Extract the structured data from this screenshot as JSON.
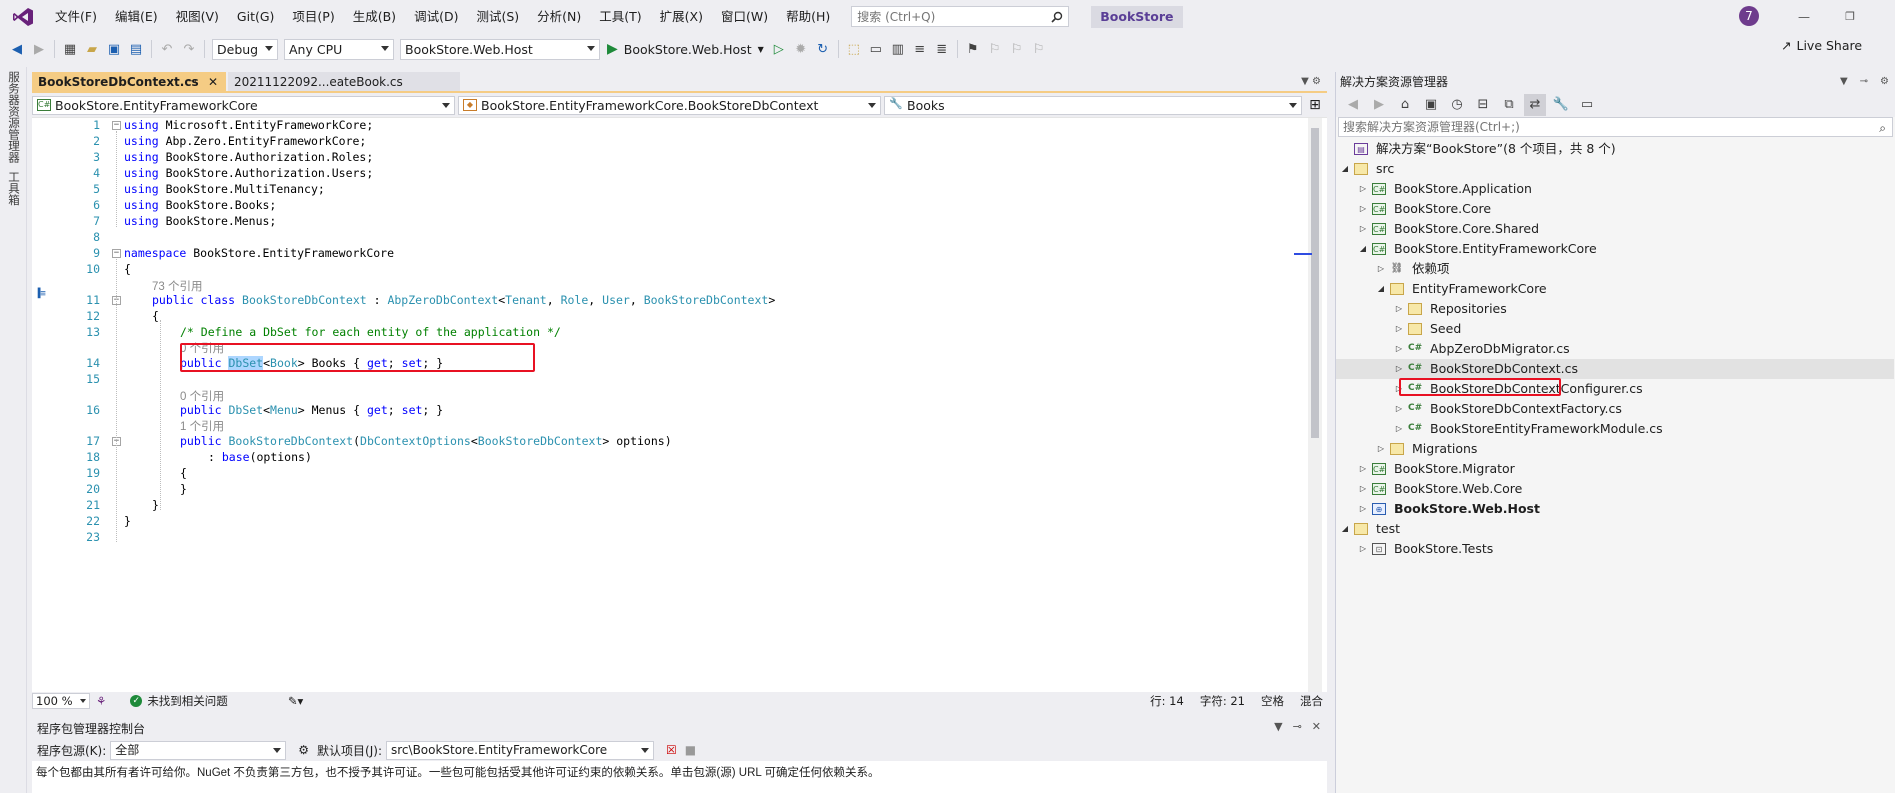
{
  "menubar": {
    "items": [
      "文件(F)",
      "编辑(E)",
      "视图(V)",
      "Git(G)",
      "项目(P)",
      "生成(B)",
      "调试(D)",
      "测试(S)",
      "分析(N)",
      "工具(T)",
      "扩展(X)",
      "窗口(W)",
      "帮助(H)"
    ],
    "search_placeholder": "搜索 (Ctrl+Q)",
    "solution_name": "BookStore",
    "notification_count": "7"
  },
  "toolbar": {
    "configuration": "Debug",
    "platform": "Any CPU",
    "startup_project": "BookStore.Web.Host",
    "run_target": "BookStore.Web.Host",
    "live_share": "Live Share"
  },
  "left_strip": {
    "tab1": "服务器资源管理器",
    "tab2": "工具箱"
  },
  "editor": {
    "tabs": [
      {
        "label": "BookStoreDbContext.cs",
        "active": true
      },
      {
        "label": "20211122092...eateBook.cs",
        "active": false
      }
    ],
    "nav_project": "BookStore.EntityFrameworkCore",
    "nav_class": "BookStore.EntityFrameworkCore.BookStoreDbContext",
    "nav_member": "Books",
    "line_numbers": [
      "1",
      "2",
      "3",
      "4",
      "5",
      "6",
      "7",
      "8",
      "9",
      "10",
      "11",
      "12",
      "13",
      "14",
      "15",
      "16",
      "17",
      "18",
      "19",
      "20",
      "21",
      "22",
      "23"
    ],
    "code": {
      "l1": "Microsoft.EntityFrameworkCore;",
      "l2": "Abp.Zero.EntityFrameworkCore;",
      "l3": "BookStore.Authorization.Roles;",
      "l4": "BookStore.Authorization.Users;",
      "l5": "BookStore.MultiTenancy;",
      "l6": "BookStore.Books;",
      "l7": "BookStore.Menus;",
      "l9": "BookStore.EntityFrameworkCore",
      "ref73": "73 个引用",
      "ref0a": "0 个引用",
      "ref0b": "0 个引用",
      "ref1": "1 个引用",
      "comment": "/* Define a DbSet for each entity of the application */"
    }
  },
  "status": {
    "zoom": "100 %",
    "issues": "未找到相关问题",
    "line": "行: 14",
    "col": "字符: 21",
    "ws": "空格",
    "eol": "混合"
  },
  "pmc": {
    "title": "程序包管理器控制台",
    "source_label": "程序包源(K):",
    "source_value": "全部",
    "project_label": "默认项目(J):",
    "project_value": "src\\BookStore.EntityFrameworkCore",
    "message": "每个包都由其所有者许可给你。NuGet 不负责第三方包，也不授予其许可证。一些包可能包括受其他许可证约束的依赖关系。单击包源(源) URL 可确定任何依赖关系。"
  },
  "solution_explorer": {
    "title": "解决方案资源管理器",
    "search_placeholder": "搜索解决方案资源管理器(Ctrl+;)",
    "tree": [
      {
        "label": "解决方案“BookStore”(8 个项目，共 8 个)",
        "level": 0,
        "icon": "solution-icon",
        "expander": ""
      },
      {
        "label": "src",
        "level": 0,
        "icon": "folder-open-icon",
        "expander": "open"
      },
      {
        "label": "BookStore.Application",
        "level": 1,
        "icon": "csharp-project-icon",
        "expander": "closed"
      },
      {
        "label": "BookStore.Core",
        "level": 1,
        "icon": "csharp-project-icon",
        "expander": "closed"
      },
      {
        "label": "BookStore.Core.Shared",
        "level": 1,
        "icon": "csharp-project-icon",
        "expander": "closed"
      },
      {
        "label": "BookStore.EntityFrameworkCore",
        "level": 1,
        "icon": "csharp-project-icon",
        "expander": "open"
      },
      {
        "label": "依赖项",
        "level": 2,
        "icon": "dependencies-icon",
        "expander": "closed"
      },
      {
        "label": "EntityFrameworkCore",
        "level": 2,
        "icon": "folder-open-icon",
        "expander": "open"
      },
      {
        "label": "Repositories",
        "level": 3,
        "icon": "folder-icon",
        "expander": "closed"
      },
      {
        "label": "Seed",
        "level": 3,
        "icon": "folder-icon",
        "expander": "closed"
      },
      {
        "label": "AbpZeroDbMigrator.cs",
        "level": 3,
        "icon": "csharp-file-icon",
        "expander": "closed"
      },
      {
        "label": "BookStoreDbContext.cs",
        "level": 3,
        "icon": "csharp-file-icon",
        "expander": "closed",
        "selected": true
      },
      {
        "label": "BookStoreDbContextConfigurer.cs",
        "level": 3,
        "icon": "csharp-file-icon",
        "expander": "closed"
      },
      {
        "label": "BookStoreDbContextFactory.cs",
        "level": 3,
        "icon": "csharp-file-icon",
        "expander": "closed"
      },
      {
        "label": "BookStoreEntityFrameworkModule.cs",
        "level": 3,
        "icon": "csharp-file-icon",
        "expander": "closed"
      },
      {
        "label": "Migrations",
        "level": 2,
        "icon": "folder-icon",
        "expander": "closed"
      },
      {
        "label": "BookStore.Migrator",
        "level": 1,
        "icon": "csharp-project-icon",
        "expander": "closed"
      },
      {
        "label": "BookStore.Web.Core",
        "level": 1,
        "icon": "csharp-project-icon",
        "expander": "closed"
      },
      {
        "label": "BookStore.Web.Host",
        "level": 1,
        "icon": "web-project-icon",
        "expander": "closed",
        "bold": true
      },
      {
        "label": "test",
        "level": 0,
        "icon": "folder-open-icon",
        "expander": "open"
      },
      {
        "label": "BookStore.Tests",
        "level": 1,
        "icon": "test-project-icon",
        "expander": "closed"
      }
    ]
  },
  "colors": {
    "accent_purple": "#68217a",
    "active_tab": "#f5cc84",
    "highlight_red": "#e81123",
    "keyword": "#0000ff",
    "type": "#2b91af",
    "comment": "#008000"
  }
}
